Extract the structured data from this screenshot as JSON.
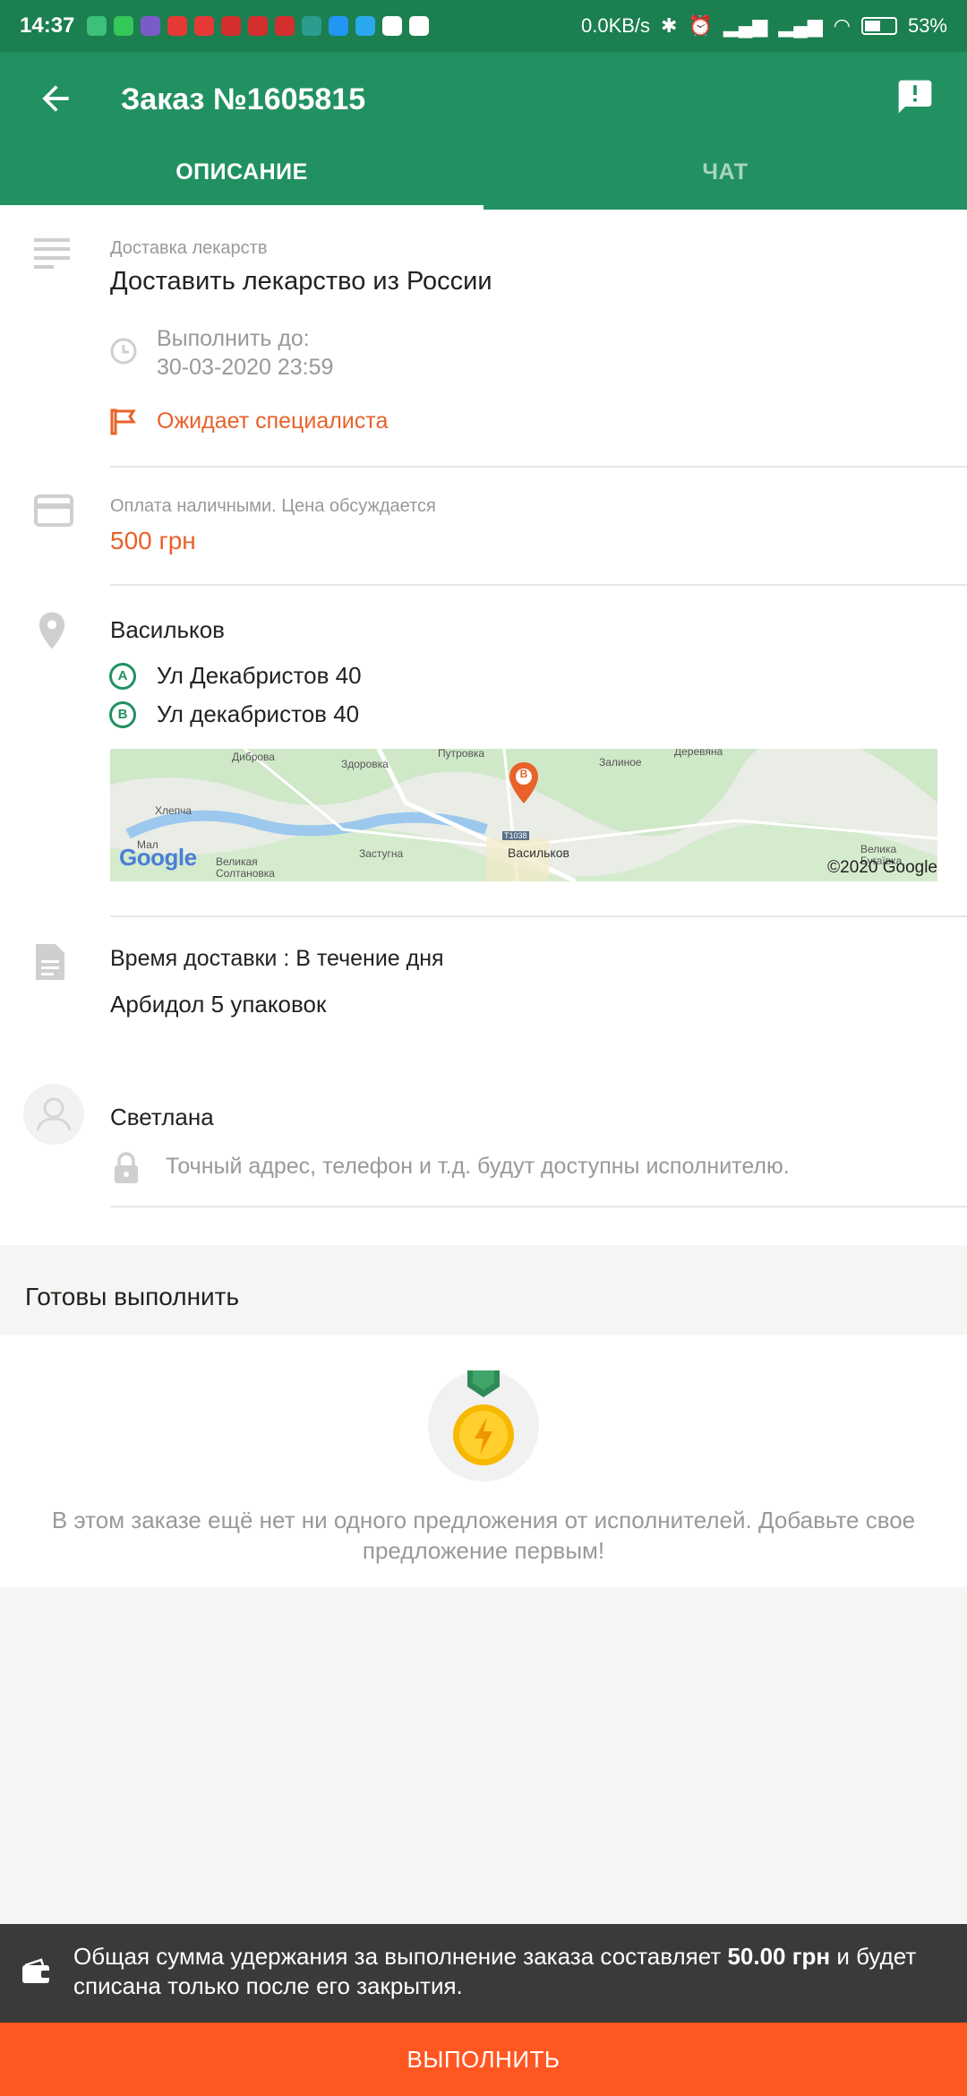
{
  "status_bar": {
    "time": "14:37",
    "network_speed": "0.0KB/s",
    "battery_percent": "53%",
    "battery_level": 0.53
  },
  "app_bar": {
    "title": "Заказ №1605815",
    "tabs": [
      {
        "label": "ОПИСАНИЕ",
        "active": true
      },
      {
        "label": "ЧАТ",
        "active": false
      }
    ]
  },
  "order": {
    "category": "Доставка лекарств",
    "title": "Доставить лекарство из России",
    "deadline_label": "Выполнить до:",
    "deadline_value": "30-03-2020 23:59",
    "status": "Ожидает специалиста",
    "payment_label": "Оплата наличными. Цена обсуждается",
    "price": "500 грн",
    "city": "Васильков",
    "point_a_badge": "A",
    "point_a": "Ул Декабристов 40",
    "point_b_badge": "B",
    "point_b": "Ул декабристов 40",
    "map": {
      "copyright": "©2020 Google",
      "logo": "Google",
      "pin_label": "B",
      "place_labels": [
        "Диброва",
        "Здоровка",
        "Путровка",
        "Залиноe",
        "Деревяна",
        "Хлепча",
        "Мал",
        "Великая Солтановка",
        "Застугна",
        "T1038",
        "Васильков",
        "Велика Бугаївка"
      ]
    },
    "delivery_time": "Время доставки : В течение дня",
    "description": "Арбидол 5 упаковок",
    "customer_name": "Светлана",
    "private_info_note": "Точный адрес, телефон и т.д. будут доступны исполнителю."
  },
  "ready_section": {
    "title": "Готовы выполнить",
    "empty_message": "В этом заказе ещё нет ни одного предложения от исполнителей. Добавьте свое предложение первым!"
  },
  "hold_notice": {
    "text_before": "Общая сумма удержания за выполнение заказа составляет ",
    "amount": "50.00 грн",
    "text_after": " и будет списана только после его закрытия."
  },
  "action_button": "ВЫПОЛНИТЬ",
  "colors": {
    "primary": "#229161",
    "status_bar": "#1b7f4f",
    "accent": "#e8622a",
    "action": "#ff5722"
  }
}
